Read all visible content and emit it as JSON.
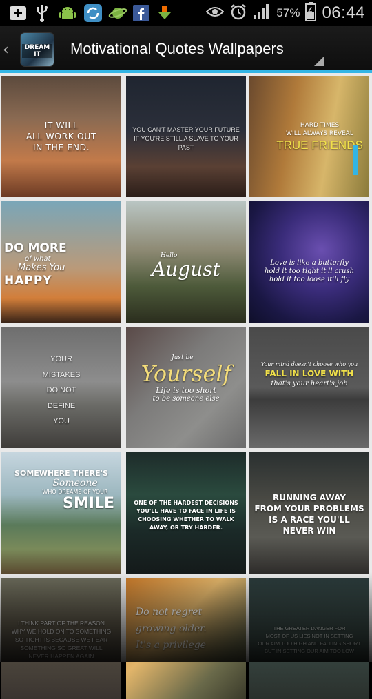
{
  "status_bar": {
    "battery_percent": "57%",
    "clock": "06:44",
    "icons": [
      "add-box-icon",
      "usb-icon",
      "android-icon",
      "sync-app-icon",
      "planet-icon",
      "facebook-icon",
      "download-icon",
      "eye-icon",
      "alarm-icon",
      "signal-icon",
      "battery-icon"
    ]
  },
  "action_bar": {
    "title": "Motivational Quotes Wallpapers",
    "app_icon_text": "DREAM IT",
    "accent_color": "#33b5e5"
  },
  "wallpapers": [
    {
      "lines": [
        "IT WILL",
        "ALL WORK OUT",
        "IN THE END."
      ]
    },
    {
      "lines": [
        "YOU CAN'T MASTER YOUR FUTURE",
        "IF YOU'RE STILL A SLAVE TO YOUR PAST"
      ]
    },
    {
      "lines": [
        "HARD TIMES",
        "WILL ALWAYS REVEAL",
        "TRUE FRIENDS"
      ]
    },
    {
      "lines": [
        "DO MORE",
        "of what",
        "Makes You",
        "HAPPY"
      ]
    },
    {
      "lines": [
        "Hello",
        "August"
      ]
    },
    {
      "lines": [
        "Love is like a butterfly",
        "hold it too tight it'll crush",
        "hold it too loose it'll fly"
      ]
    },
    {
      "lines": [
        "YOUR",
        "MISTAKES",
        "DO NOT",
        "DEFINE",
        "YOU"
      ]
    },
    {
      "lines": [
        "Just be",
        "Yourself",
        "Life is too short",
        "to be someone else"
      ]
    },
    {
      "lines": [
        "Your mind doesn't choose who you",
        "FALL IN LOVE WITH",
        "that's your heart's job"
      ]
    },
    {
      "lines": [
        "SOMEWHERE THERE'S",
        "Someone",
        "WHO DREAMS OF YOUR",
        "SMILE"
      ]
    },
    {
      "lines": [
        "ONE OF THE HARDEST DECISIONS",
        "YOU'LL HAVE TO FACE IN LIFE IS",
        "CHOOSING WHETHER TO WALK",
        "AWAY, OR TRY HARDER."
      ]
    },
    {
      "lines": [
        "RUNNING AWAY",
        "FROM YOUR PROBLEMS",
        "IS A RACE YOU'LL",
        "NEVER WIN"
      ]
    },
    {
      "lines": [
        "I THINK PART OF THE REASON",
        "WHY WE HOLD ON TO SOMETHING",
        "SO TIGHT IS BECAUSE WE FEAR",
        "SOMETHING SO GREAT WILL",
        "NEVER HAPPEN AGAIN"
      ]
    },
    {
      "lines": [
        "Do not regret",
        "growing older.",
        "It's a privilege"
      ]
    },
    {
      "lines": [
        "THE GREATER DANGER FOR",
        "MOST OF US LIES NOT IN SETTING",
        "OUR AIM TOO HIGH AND FALLING SHORT",
        "BUT IN SETTING OUR AIM TOO LOW"
      ]
    }
  ]
}
